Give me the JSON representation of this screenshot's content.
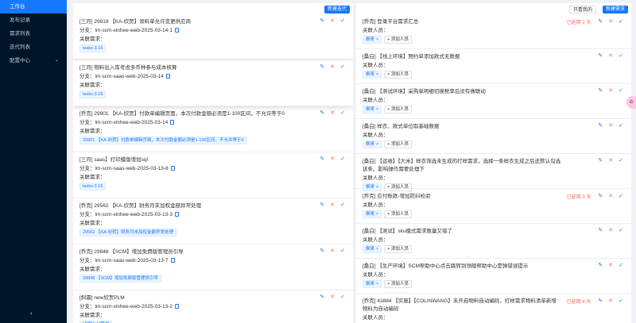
{
  "sidebar": {
    "items": [
      {
        "label": "工作台",
        "active": true
      },
      {
        "label": "发布记录",
        "active": false
      },
      {
        "label": "需求列表",
        "active": false
      },
      {
        "label": "迭代列表",
        "active": false
      },
      {
        "label": "配置中心",
        "active": false,
        "has_children": true
      }
    ],
    "collapse_glyph": "‹"
  },
  "left_panel": {
    "new_button": "新建迭代",
    "labels": {
      "branch": "分支：",
      "related": "关联需求："
    },
    "cards": [
      {
        "title": "[三月] 29918 【KA-欣贺】领料单允许变更供应商",
        "branch": "lm-scm-xinhee-web-2025-03-14-1",
        "tag": "tasks-3.16"
      },
      {
        "title": "[三月] 物料出入库考虑多币种参与成本核算",
        "branch": "lm-scm-saas-web-2025-03-14",
        "tag": "tasks-3.16"
      },
      {
        "title": "[乔克] 29901 【KA-欣贺】付款单编辑页面，本次付款金额必须是1-100区间，不允许等于0",
        "branch": "lm-scm-xinhee-web-2025-03-14",
        "tag": "29901 【KA-欣贺】付款单编辑页面，本次付款金额必须是1-100区间，不允许等于0"
      },
      {
        "title": "[三月] saas】打印模版增加sql",
        "branch": "lm-scm-saas-web-2025-03-13-8",
        "tag": "tasks-3.16"
      },
      {
        "title": "[乔克] 29562 【KA-欣贺】财务月末加权金额异常处理",
        "branch": "lm-scm-xinhee-web-2025-03-13-3",
        "tag": "29562 【KA-欣贺】财务月末加权金额异常处理"
      },
      {
        "title": "[乔克] 29848 【SCM】增加免费版管理员引导",
        "branch": "lm-scm-saas-web-2025-03-13-7",
        "tag": "29848 【SCM】增加免费版管理员引导"
      },
      {
        "title": "[斜霜] new欣贺PLM",
        "branch": "lm-scm-xinhee-web-2025-03-13-2",
        "tag": "欣贺PLM需求"
      }
    ]
  },
  "right_panel": {
    "filter_button": "只看我的",
    "new_button": "新建需求",
    "labels": {
      "person": "关联人员：",
      "add_person": "添加人员"
    },
    "cards": [
      {
        "title": "[乔克] 登录平台需求汇总",
        "overdue": "已延期 2 天",
        "person": "枫哥"
      },
      {
        "title": "[桑白] 【线上环境】预约单添加款式无数据",
        "overdue": "",
        "person": "枫哥"
      },
      {
        "title": "[桑白] 【测试环境】采购单明细切换税率后没有做联动",
        "overdue": "",
        "person": "枫哥"
      },
      {
        "title": "[桑白] 样衣、款式单位取基础数据",
        "overdue": "",
        "person": "枫哥"
      },
      {
        "title": "[桑白] 【运维】【大米】样衣饰选未生成的打样需求，选择一条样衣生成之后还默认勾选该条。影响操作需要处理下",
        "overdue": "",
        "person": "枫哥"
      },
      {
        "title": "[乔克] 应付账款-增加防抖检验",
        "overdue": "已延期 3 天",
        "person": "枫哥"
      },
      {
        "title": "[桑白] 【测试】sku模式需求数量又错了",
        "overdue": "",
        "person": "枫哥"
      },
      {
        "title": "[桑白] 【生产环境】SCM帮助中心点击跳转到领舰帮助中心是弹错误提示",
        "overdue": "",
        "person": "枫哥"
      },
      {
        "title": "[乔克] 43884 【实施】【COLINWANG】未开启物料自动编码，打样需求物料清单新增物料为自动编码",
        "overdue": "已延期 4 天",
        "person": "枫哥"
      }
    ]
  },
  "icons": {
    "edit": "✎",
    "delete": "✕",
    "confirm": "✓",
    "plus": "+",
    "tag_close": "×"
  },
  "colors": {
    "primary": "#1677ff",
    "danger": "#f56c6c",
    "sidebar_bg": "#001529"
  }
}
